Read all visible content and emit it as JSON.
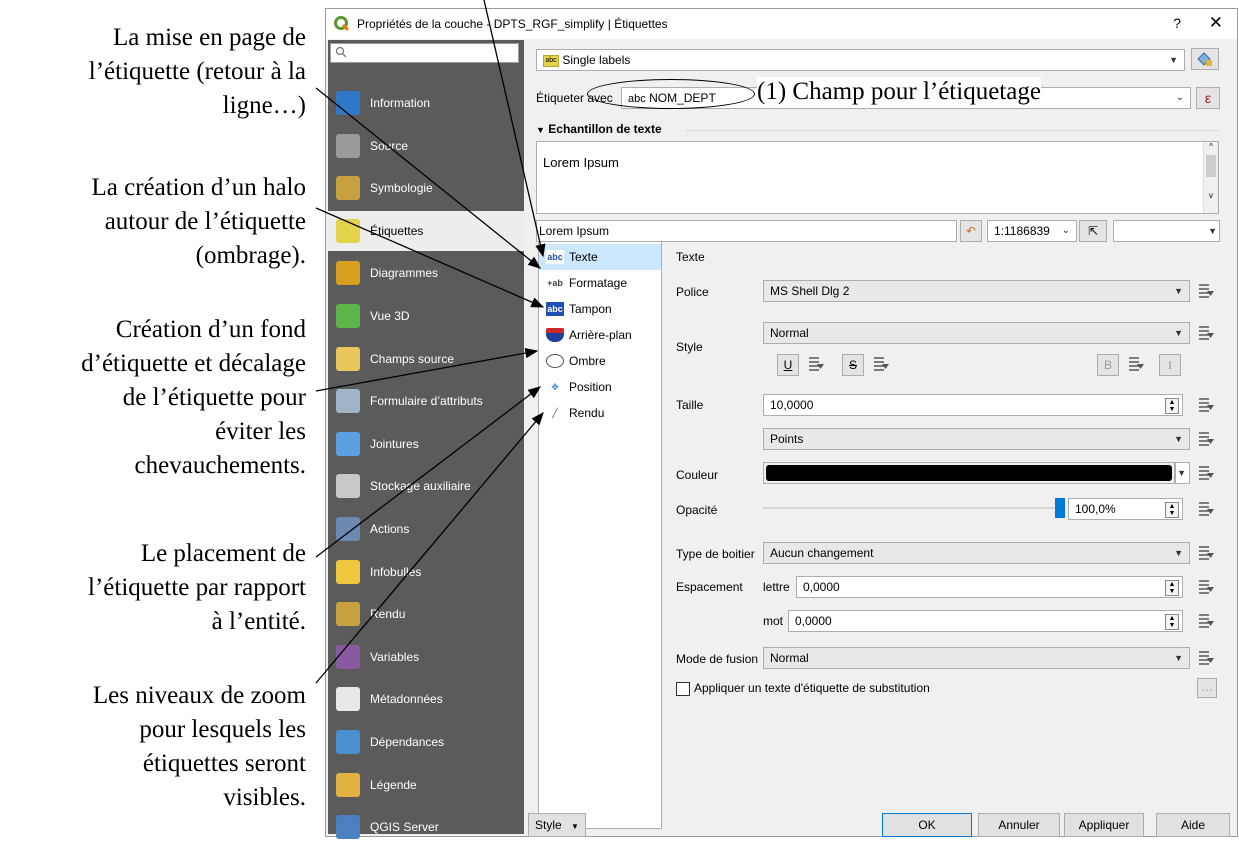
{
  "annotations": {
    "layout": [
      "La mise en page de",
      "l’étiquette (retour à la",
      "ligne…)"
    ],
    "halo": [
      "La création d’un halo",
      "autour de l’étiquette",
      "(ombrage)."
    ],
    "background": [
      "Création d’un fond",
      "d’étiquette et décalage",
      "de l’étiquette pour",
      "éviter les",
      "chevauchements."
    ],
    "placement": [
      "Le placement de",
      "l’étiquette par rapport",
      "à l’entité."
    ],
    "zoom": [
      "Les niveaux de zoom",
      "pour lesquels les",
      "étiquettes seront",
      "visibles."
    ],
    "field_note": "(1) Champ pour l’étiquetage"
  },
  "window": {
    "title": "Propriétés de la couche - DPTS_RGF_simplify | Étiquettes",
    "help": "?",
    "close": "✕"
  },
  "sidebar": {
    "search_placeholder": "",
    "items": [
      {
        "label": "Information",
        "icon": "info-icon",
        "color": "#2e78c7"
      },
      {
        "label": "Source",
        "icon": "wrench-icon",
        "color": "#9a9a9a"
      },
      {
        "label": "Symbologie",
        "icon": "brush-icon",
        "color": "#c8a040"
      },
      {
        "label": "Étiquettes",
        "icon": "abc-label-icon",
        "color": "#e3d34c"
      },
      {
        "label": "Diagrammes",
        "icon": "diagram-icon",
        "color": "#d9a020"
      },
      {
        "label": "Vue 3D",
        "icon": "cube-icon",
        "color": "#5bb548"
      },
      {
        "label": "Champs source",
        "icon": "fields-icon",
        "color": "#e8c85a"
      },
      {
        "label": "Formulaire d’attributs",
        "icon": "form-icon",
        "color": "#a0b4c8"
      },
      {
        "label": "Jointures",
        "icon": "join-icon",
        "color": "#5aa0e0"
      },
      {
        "label": "Stockage auxiliaire",
        "icon": "database-icon",
        "color": "#c8c8c8"
      },
      {
        "label": "Actions",
        "icon": "gear-icon",
        "color": "#6a8ab0"
      },
      {
        "label": "Infobulles",
        "icon": "tooltip-icon",
        "color": "#f0c840"
      },
      {
        "label": "Rendu",
        "icon": "render-brush-icon",
        "color": "#c8a040"
      },
      {
        "label": "Variables",
        "icon": "variables-icon",
        "color": "#8a5aa0"
      },
      {
        "label": "Métadonnées",
        "icon": "metadata-icon",
        "color": "#e8e8e8"
      },
      {
        "label": "Dépendances",
        "icon": "dependencies-icon",
        "color": "#4a90d0"
      },
      {
        "label": "Légende",
        "icon": "legend-icon",
        "color": "#e0b040"
      },
      {
        "label": "QGIS Server",
        "icon": "server-icon",
        "color": "#4a80c0"
      }
    ],
    "active": "Étiquettes"
  },
  "labels_panel": {
    "mode": "Single labels",
    "label_with": "Étiqueter avec",
    "field_prefix": "abc",
    "field": "NOM_DEPT",
    "sample_header": "Echantillon de texte",
    "sample_text": "Lorem Ipsum",
    "preview_text": "Lorem Ipsum",
    "scale": "1:1186839",
    "epsilon": "ε"
  },
  "subtabs": [
    {
      "label": "Texte",
      "icon": "abc"
    },
    {
      "label": "Formatage",
      "icon": "+ab"
    },
    {
      "label": "Tampon",
      "icon": "abc"
    },
    {
      "label": "Arrière-plan",
      "icon": "shield"
    },
    {
      "label": "Ombre",
      "icon": "shadow"
    },
    {
      "label": "Position",
      "icon": "position"
    },
    {
      "label": "Rendu",
      "icon": "brush"
    }
  ],
  "text_section": {
    "header": "Texte",
    "font_label": "Police",
    "font_value": "MS Shell Dlg 2",
    "style_label": "Style",
    "style_value": "Normal",
    "underline": "U",
    "strike": "S",
    "bold": "B",
    "italic": "I",
    "size_label": "Taille",
    "size_value": "10,0000",
    "unit_value": "Points",
    "color_label": "Couleur",
    "color_value": "#000000",
    "opacity_label": "Opacité",
    "opacity_value": "100,0%",
    "opacity_fraction": 1.0,
    "case_label": "Type de boitier",
    "case_value": "Aucun changement",
    "spacing_label": "Espacement",
    "letter_label": "lettre",
    "letter_value": "0,0000",
    "word_label": "mot",
    "word_value": "0,0000",
    "blend_label": "Mode de fusion",
    "blend_value": "Normal",
    "substitute_label": "Appliquer un texte d'étiquette de substitution",
    "substitute_btn": "…"
  },
  "footer": {
    "style": "Style",
    "ok": "OK",
    "cancel": "Annuler",
    "apply": "Appliquer",
    "help": "Aide"
  }
}
